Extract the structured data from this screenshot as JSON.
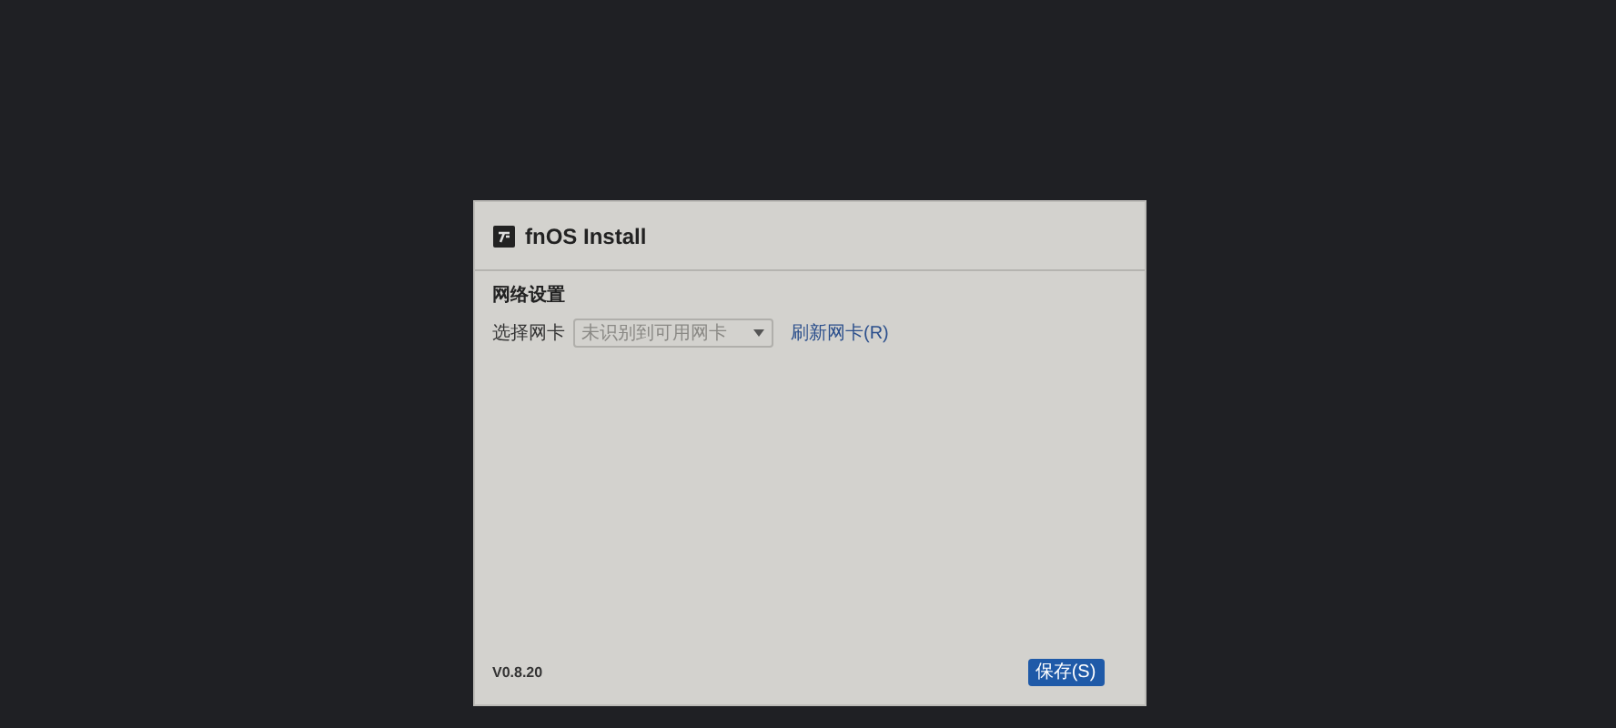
{
  "window": {
    "title": "fnOS Install"
  },
  "network": {
    "heading": "网络设置",
    "nic_label": "选择网卡",
    "nic_select": {
      "placeholder": "未识别到可用网卡"
    },
    "refresh_link": "刷新网卡(R)"
  },
  "footer": {
    "version": "V0.8.20",
    "save_button": "保存(S)"
  }
}
